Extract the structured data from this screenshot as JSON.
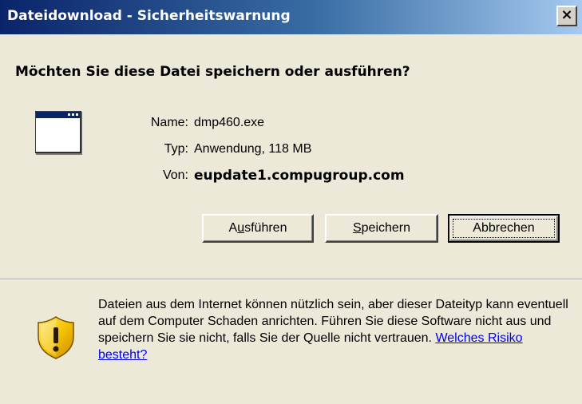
{
  "window": {
    "title": "Dateidownload - Sicherheitswarnung",
    "close_label": "×"
  },
  "question": "Möchten Sie diese Datei speichern oder ausführen?",
  "file": {
    "name_label": "Name:",
    "name_value": "dmp460.exe",
    "type_label": "Typ:",
    "type_value": "Anwendung, 118 MB",
    "from_label": "Von:",
    "from_value": "eupdate1.compugroup.com"
  },
  "buttons": {
    "run": {
      "before": "A",
      "accel": "u",
      "after": "sführen"
    },
    "save": {
      "before": "",
      "accel": "S",
      "after": "peichern"
    },
    "cancel": {
      "label": "Abbrechen"
    }
  },
  "warning": {
    "text": "Dateien aus dem Internet können nützlich sein, aber dieser Dateityp kann eventuell auf dem Computer Schaden anrichten. Führen Sie diese Software nicht aus und speichern Sie sie nicht, falls Sie der Quelle nicht vertrauen.",
    "link": "Welches Risiko besteht?"
  },
  "icons": {
    "app": "application-window-icon",
    "warning": "security-shield-warning-icon"
  },
  "colors": {
    "title_bar_start": "#0a246a",
    "title_bar_end": "#a6caf0",
    "dialog_background": "#ece9d8",
    "link": "#0000ee",
    "shield": "#f5c400"
  }
}
